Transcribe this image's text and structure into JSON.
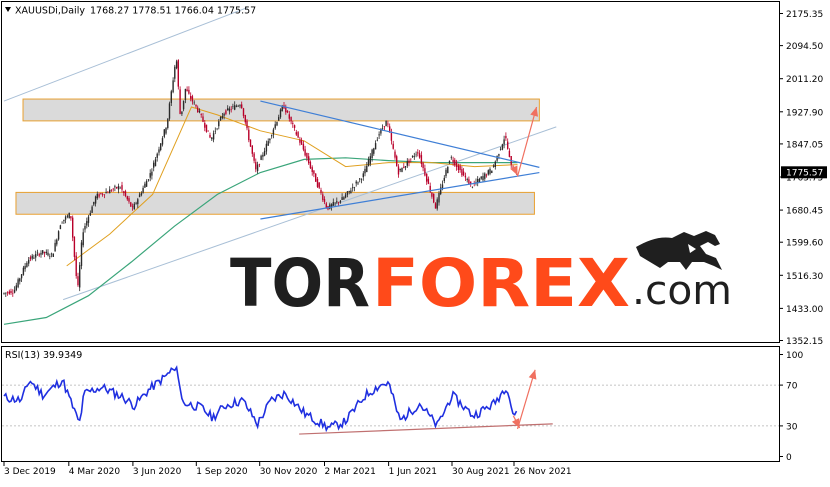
{
  "chart_data": {
    "type": "candlestick",
    "symbol_header": {
      "instrument": "XAUUSDi,Daily",
      "ohlc": "1768.27 1778.51 1766.04 1775.57"
    },
    "price_axis": {
      "ylim": [
        1352.15,
        2175.35
      ],
      "ticks": [
        "2175.35",
        "2094.50",
        "2011.20",
        "1927.90",
        "1847.05",
        "1763.75",
        "1680.45",
        "1599.60",
        "1516.30",
        "1433.00",
        "1352.15"
      ],
      "tick_values": [
        2175.35,
        2094.5,
        2011.2,
        1927.9,
        1847.05,
        1763.75,
        1680.45,
        1599.6,
        1516.3,
        1433.0,
        1352.15
      ],
      "current_price_label": "1775.57",
      "current_price": 1775.57
    },
    "time_axis": {
      "ticks": [
        "3 Dec 2019",
        "4 Mar 2020",
        "3 Jun 2020",
        "1 Sep 2020",
        "30 Nov 2020",
        "2 Mar 2021",
        "1 Jun 2021",
        "30 Aug 2021",
        "26 Nov 2021"
      ],
      "tick_dates": [
        "2019-12-03",
        "2020-03-04",
        "2020-06-03",
        "2020-09-01",
        "2020-11-30",
        "2021-03-02",
        "2021-06-01",
        "2021-08-30",
        "2021-11-26"
      ]
    },
    "price_path": [
      [
        "2019-12-03",
        1470
      ],
      [
        "2019-12-20",
        1478
      ],
      [
        "2020-01-08",
        1555
      ],
      [
        "2020-01-28",
        1575
      ],
      [
        "2020-02-12",
        1566
      ],
      [
        "2020-02-24",
        1650
      ],
      [
        "2020-03-09",
        1672
      ],
      [
        "2020-03-19",
        1475
      ],
      [
        "2020-03-26",
        1625
      ],
      [
        "2020-04-14",
        1715
      ],
      [
        "2020-05-18",
        1740
      ],
      [
        "2020-06-05",
        1683
      ],
      [
        "2020-07-01",
        1775
      ],
      [
        "2020-07-24",
        1900
      ],
      [
        "2020-08-06",
        2068
      ],
      [
        "2020-08-12",
        1910
      ],
      [
        "2020-08-19",
        1985
      ],
      [
        "2020-09-08",
        1925
      ],
      [
        "2020-09-24",
        1858
      ],
      [
        "2020-10-12",
        1925
      ],
      [
        "2020-11-06",
        1950
      ],
      [
        "2020-11-27",
        1780
      ],
      [
        "2020-12-16",
        1860
      ],
      [
        "2021-01-05",
        1945
      ],
      [
        "2021-02-02",
        1835
      ],
      [
        "2021-03-08",
        1685
      ],
      [
        "2021-03-31",
        1710
      ],
      [
        "2021-04-29",
        1770
      ],
      [
        "2021-05-20",
        1870
      ],
      [
        "2021-06-01",
        1905
      ],
      [
        "2021-06-17",
        1775
      ],
      [
        "2021-07-15",
        1828
      ],
      [
        "2021-08-09",
        1688
      ],
      [
        "2021-08-30",
        1815
      ],
      [
        "2021-09-29",
        1740
      ],
      [
        "2021-10-29",
        1785
      ],
      [
        "2021-11-16",
        1868
      ],
      [
        "2021-11-24",
        1792
      ],
      [
        "2021-12-01",
        1776
      ]
    ],
    "ma_fast": [
      [
        "2020-03-01",
        1540
      ],
      [
        "2020-05-01",
        1620
      ],
      [
        "2020-07-01",
        1720
      ],
      [
        "2020-08-25",
        1940
      ],
      [
        "2020-10-01",
        1920
      ],
      [
        "2020-12-01",
        1880
      ],
      [
        "2021-02-01",
        1855
      ],
      [
        "2021-04-01",
        1790
      ],
      [
        "2021-06-01",
        1800
      ],
      [
        "2021-08-01",
        1800
      ],
      [
        "2021-10-01",
        1790
      ],
      [
        "2021-12-01",
        1795
      ]
    ],
    "ma_slow": [
      [
        "2019-12-03",
        1393
      ],
      [
        "2020-02-01",
        1410
      ],
      [
        "2020-04-01",
        1465
      ],
      [
        "2020-06-01",
        1550
      ],
      [
        "2020-08-01",
        1640
      ],
      [
        "2020-10-01",
        1720
      ],
      [
        "2020-12-01",
        1775
      ],
      [
        "2021-02-01",
        1808
      ],
      [
        "2021-04-01",
        1812
      ],
      [
        "2021-06-01",
        1805
      ],
      [
        "2021-08-01",
        1800
      ],
      [
        "2021-10-01",
        1800
      ],
      [
        "2021-12-01",
        1800
      ]
    ],
    "zones": [
      {
        "from": "2019-12-30",
        "to": "2022-01-01",
        "price_low": 1905,
        "price_high": 1960
      },
      {
        "from": "2019-12-20",
        "to": "2021-12-25",
        "price_low": 1670,
        "price_high": 1725
      }
    ],
    "trendlines": [
      {
        "from": [
          "2020-12-01",
          1955
        ],
        "to": [
          "2022-01-01",
          1788
        ]
      },
      {
        "from": [
          "2020-12-01",
          1658
        ],
        "to": [
          "2022-01-01",
          1775
        ]
      },
      {
        "from": [
          "2020-02-25",
          1455
        ],
        "to": [
          "2022-01-25",
          1890
        ]
      },
      {
        "from": [
          "2019-12-03",
          1955
        ],
        "to": [
          "2020-11-12",
          2190
        ]
      }
    ],
    "forecast_arrows": [
      {
        "from": [
          "2021-12-01",
          1765
        ],
        "to": [
          "2021-12-28",
          1940
        ]
      },
      {
        "from": [
          "2021-11-24",
          1795
        ],
        "to": [
          "2021-12-01",
          1768
        ]
      }
    ],
    "rsi": {
      "header": "RSI(13) 39.9349",
      "ylim": [
        0,
        100
      ],
      "ticks": [
        "100",
        "70",
        "30",
        "0"
      ],
      "tick_values": [
        100,
        70,
        30,
        0
      ],
      "path": [
        [
          "2019-12-03",
          58
        ],
        [
          "2019-12-28",
          55
        ],
        [
          "2020-01-08",
          75
        ],
        [
          "2020-01-28",
          60
        ],
        [
          "2020-02-24",
          75
        ],
        [
          "2020-03-19",
          32
        ],
        [
          "2020-03-26",
          62
        ],
        [
          "2020-04-20",
          68
        ],
        [
          "2020-05-20",
          58
        ],
        [
          "2020-06-05",
          50
        ],
        [
          "2020-06-25",
          65
        ],
        [
          "2020-07-22",
          80
        ],
        [
          "2020-07-28",
          85
        ],
        [
          "2020-08-06",
          83
        ],
        [
          "2020-08-12",
          53
        ],
        [
          "2020-09-08",
          48
        ],
        [
          "2020-09-24",
          38
        ],
        [
          "2020-10-12",
          50
        ],
        [
          "2020-11-06",
          55
        ],
        [
          "2020-11-27",
          32
        ],
        [
          "2020-12-16",
          55
        ],
        [
          "2021-01-05",
          62
        ],
        [
          "2021-02-02",
          42
        ],
        [
          "2021-03-08",
          28
        ],
        [
          "2021-03-31",
          34
        ],
        [
          "2021-04-29",
          60
        ],
        [
          "2021-05-20",
          70
        ],
        [
          "2021-06-01",
          72
        ],
        [
          "2021-06-17",
          35
        ],
        [
          "2021-07-15",
          52
        ],
        [
          "2021-08-09",
          30
        ],
        [
          "2021-08-30",
          60
        ],
        [
          "2021-09-29",
          40
        ],
        [
          "2021-10-29",
          52
        ],
        [
          "2021-11-16",
          70
        ],
        [
          "2021-11-24",
          43
        ],
        [
          "2021-12-01",
          40
        ]
      ],
      "support_line": {
        "from": [
          "2021-01-25",
          22
        ],
        "to": [
          "2022-01-20",
          32
        ]
      },
      "arrows": [
        {
          "from": [
            "2021-12-01",
            27
          ],
          "to": [
            "2021-12-26",
            85
          ]
        },
        {
          "from": [
            "2021-11-25",
            40
          ],
          "to": [
            "2021-12-04",
            28
          ]
        }
      ]
    },
    "colors": {
      "bull": "#2a2a2a",
      "bear": "#b8002a",
      "ma_fast": "#e0a020",
      "ma_slow": "#3aa57a",
      "trend": "#3f7fd6",
      "channel": "#a8bfd6",
      "arrow": "#f07060",
      "zone_fill": "#dadada",
      "zone_border": "#e8a030",
      "rsi": "#1f2fe0",
      "rsi_support": "#c07070"
    }
  },
  "watermark": {
    "tor": "TOR",
    "forex": "FOREX",
    "dotcom": ".com",
    "mark": "bull-logo"
  }
}
